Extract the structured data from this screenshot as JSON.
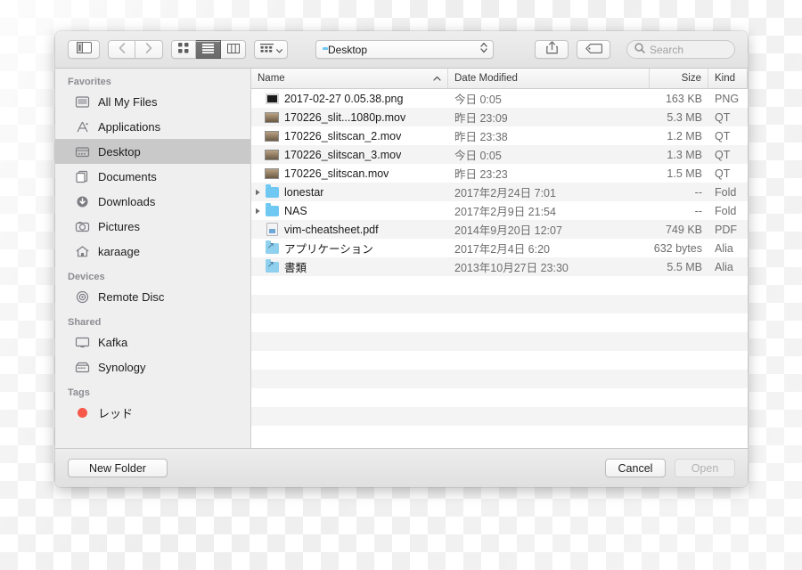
{
  "toolbar": {
    "sidebar_toggle_icon": "sidebar-toggle-icon",
    "back_icon": "chevron-left-icon",
    "forward_icon": "chevron-right-icon",
    "view_icon_grid": "icon-view-icon",
    "view_list": "list-view-icon",
    "view_column": "column-view-icon",
    "arrange_icon": "arrange-by-icon",
    "arrange_chevron": "chevron-down-icon",
    "path_label": "Desktop",
    "path_folder_icon": "folder-icon",
    "path_stepper_icon": "up-down-chevron-icon",
    "share_icon": "share-icon",
    "tag_icon": "tag-icon",
    "search_icon": "search-icon",
    "search_placeholder": "Search",
    "search_value": ""
  },
  "sidebar": {
    "groups": [
      {
        "title": "Favorites",
        "items": [
          {
            "label": "All My Files",
            "icon": "all-my-files-icon",
            "selected": false
          },
          {
            "label": "Applications",
            "icon": "applications-icon",
            "selected": false
          },
          {
            "label": "Desktop",
            "icon": "desktop-icon",
            "selected": true
          },
          {
            "label": "Documents",
            "icon": "documents-icon",
            "selected": false
          },
          {
            "label": "Downloads",
            "icon": "downloads-icon",
            "selected": false
          },
          {
            "label": "Pictures",
            "icon": "pictures-icon",
            "selected": false
          },
          {
            "label": "karaage",
            "icon": "home-icon",
            "selected": false
          }
        ]
      },
      {
        "title": "Devices",
        "items": [
          {
            "label": "Remote Disc",
            "icon": "disc-icon",
            "selected": false
          }
        ]
      },
      {
        "title": "Shared",
        "items": [
          {
            "label": "Kafka",
            "icon": "display-icon",
            "selected": false
          },
          {
            "label": "Synology",
            "icon": "server-icon",
            "selected": false
          }
        ]
      },
      {
        "title": "Tags",
        "items": [
          {
            "label": "レッド",
            "icon": "red-dot-icon",
            "selected": false
          }
        ]
      }
    ]
  },
  "filelist": {
    "columns": [
      {
        "label": "Name",
        "sorted": true,
        "sort_icon": "chevron-up-icon"
      },
      {
        "label": "Date Modified",
        "sorted": false
      },
      {
        "label": "Size",
        "sorted": false
      },
      {
        "label": "Kind",
        "sorted": false
      }
    ],
    "rows": [
      {
        "name": "2017-02-27 0.05.38.png",
        "date": "今日 0:05",
        "size": "163 KB",
        "kind": "PNG",
        "icon": "png-thumbnail-icon",
        "expandable": false
      },
      {
        "name": "170226_slit...1080p.mov",
        "date": "昨日 23:09",
        "size": "5.3 MB",
        "kind": "QT",
        "icon": "movie-thumbnail-icon",
        "expandable": false
      },
      {
        "name": "170226_slitscan_2.mov",
        "date": "昨日 23:38",
        "size": "1.2 MB",
        "kind": "QT",
        "icon": "movie-thumbnail-icon",
        "expandable": false
      },
      {
        "name": "170226_slitscan_3.mov",
        "date": "今日 0:05",
        "size": "1.3 MB",
        "kind": "QT",
        "icon": "movie-thumbnail-icon",
        "expandable": false
      },
      {
        "name": "170226_slitscan.mov",
        "date": "昨日 23:23",
        "size": "1.5 MB",
        "kind": "QT",
        "icon": "movie-thumbnail-icon",
        "expandable": false
      },
      {
        "name": "lonestar",
        "date": "2017年2月24日 7:01",
        "size": "--",
        "kind": "Fold",
        "icon": "folder-icon",
        "expandable": true
      },
      {
        "name": "NAS",
        "date": "2017年2月9日 21:54",
        "size": "--",
        "kind": "Fold",
        "icon": "folder-icon",
        "expandable": true
      },
      {
        "name": "vim-cheatsheet.pdf",
        "date": "2014年9月20日 12:07",
        "size": "749 KB",
        "kind": "PDF",
        "icon": "pdf-icon",
        "expandable": false
      },
      {
        "name": "アプリケーション",
        "date": "2017年2月4日 6:20",
        "size": "632 bytes",
        "kind": "Alia",
        "icon": "alias-icon",
        "expandable": false
      },
      {
        "name": "書類",
        "date": "2013年10月27日 23:30",
        "size": "5.5 MB",
        "kind": "Alia",
        "icon": "alias-icon",
        "expandable": false
      }
    ],
    "empty_row_count": 9
  },
  "footer": {
    "new_folder_label": "New Folder",
    "cancel_label": "Cancel",
    "open_label": "Open",
    "open_disabled": true
  },
  "colors": {
    "folder_blue": "#6ec8f2",
    "selection_gray": "#c9c9c9",
    "tag_red": "#f7584a",
    "stripe": "#f4f4f4"
  }
}
